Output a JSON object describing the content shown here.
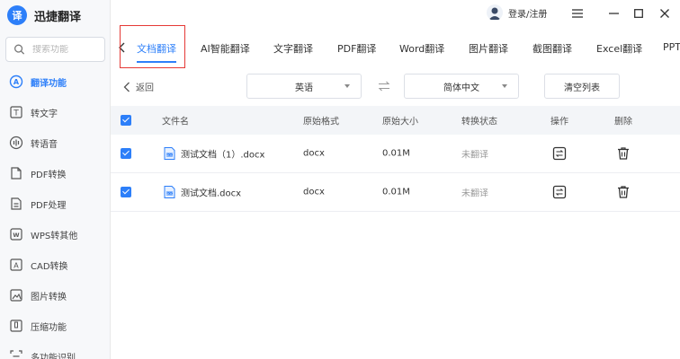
{
  "app": {
    "logo_glyph": "译",
    "title": "迅捷翻译",
    "accent": "#2d7ff9"
  },
  "search": {
    "placeholder": "搜索功能"
  },
  "sidebar": {
    "items": [
      {
        "label": "翻译功能",
        "icon": "translate-icon",
        "active": true
      },
      {
        "label": "转文字",
        "icon": "text-convert-icon"
      },
      {
        "label": "转语音",
        "icon": "voice-icon"
      },
      {
        "label": "PDF转换",
        "icon": "pdf-convert-icon"
      },
      {
        "label": "PDF处理",
        "icon": "pdf-process-icon"
      },
      {
        "label": "WPS转其他",
        "icon": "wps-icon"
      },
      {
        "label": "CAD转换",
        "icon": "cad-icon"
      },
      {
        "label": "图片转换",
        "icon": "image-convert-icon"
      },
      {
        "label": "压缩功能",
        "icon": "compress-icon"
      },
      {
        "label": "多功能识别",
        "icon": "recognize-icon"
      }
    ]
  },
  "account": {
    "login_label": "登录/注册"
  },
  "tabs": [
    {
      "label": "文档翻译",
      "active": true
    },
    {
      "label": "AI智能翻译"
    },
    {
      "label": "文字翻译"
    },
    {
      "label": "PDF翻译"
    },
    {
      "label": "Word翻译"
    },
    {
      "label": "图片翻译"
    },
    {
      "label": "截图翻译"
    },
    {
      "label": "Excel翻译"
    },
    {
      "label": "PPT"
    }
  ],
  "toolbar": {
    "back_label": "返回",
    "source_lang": "英语",
    "target_lang": "简体中文",
    "clear_label": "清空列表"
  },
  "table": {
    "headers": {
      "filename": "文件名",
      "format": "原始格式",
      "size": "原始大小",
      "status": "转换状态",
      "action": "操作",
      "delete": "删除"
    },
    "rows": [
      {
        "filename": "测试文档（1）.docx",
        "format": "docx",
        "size": "0.01M",
        "status": "未翻译"
      },
      {
        "filename": "测试文档.docx",
        "format": "docx",
        "size": "0.01M",
        "status": "未翻译"
      }
    ]
  }
}
